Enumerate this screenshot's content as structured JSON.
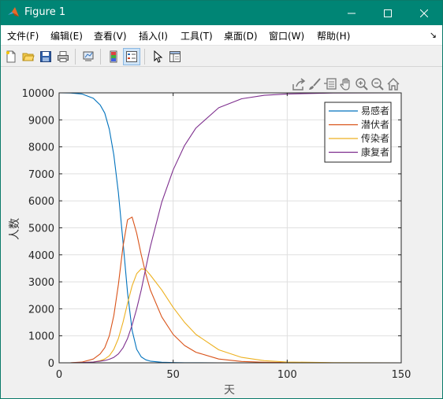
{
  "window": {
    "title": "Figure 1"
  },
  "menu": {
    "items": [
      "文件(F)",
      "编辑(E)",
      "查看(V)",
      "插入(I)",
      "工具(T)",
      "桌面(D)",
      "窗口(W)",
      "帮助(H)"
    ]
  },
  "toolbar": {
    "buttons": [
      "new-figure",
      "open-file",
      "save",
      "print",
      "link-plot",
      "insert-colorbar",
      "insert-legend",
      "edit-plot",
      "property-inspector"
    ]
  },
  "axes_toolbar": {
    "buttons": [
      "export",
      "brush",
      "data-tips",
      "pan",
      "zoom-in",
      "zoom-out",
      "restore-view"
    ]
  },
  "chart_data": {
    "type": "line",
    "title": "",
    "xlabel": "天",
    "ylabel": "人数",
    "xlim": [
      0,
      150
    ],
    "ylim": [
      0,
      10000
    ],
    "xticks": [
      0,
      50,
      100,
      150
    ],
    "yticks": [
      0,
      1000,
      2000,
      3000,
      4000,
      5000,
      6000,
      7000,
      8000,
      9000,
      10000
    ],
    "grid": true,
    "legend_position": "top-right",
    "x": [
      0,
      5,
      10,
      15,
      18,
      20,
      22,
      24,
      26,
      28,
      30,
      32,
      34,
      36,
      38,
      40,
      45,
      50,
      55,
      60,
      70,
      80,
      90,
      100,
      120,
      150
    ],
    "series": [
      {
        "name": "易感者",
        "color": "#0072BD",
        "values": [
          10000,
          9995,
          9960,
          9800,
          9550,
          9250,
          8650,
          7700,
          6300,
          4500,
          2600,
          1200,
          500,
          220,
          110,
          60,
          20,
          8,
          4,
          2,
          1,
          0,
          0,
          0,
          0,
          0
        ]
      },
      {
        "name": "潜伏者",
        "color": "#D95319",
        "values": [
          0,
          3,
          25,
          140,
          330,
          560,
          1000,
          1750,
          2900,
          4300,
          5300,
          5400,
          4800,
          4000,
          3300,
          2700,
          1700,
          1050,
          640,
          390,
          140,
          50,
          20,
          8,
          1,
          0
        ]
      },
      {
        "name": "传染者",
        "color": "#EDB120",
        "values": [
          0,
          1,
          6,
          30,
          80,
          140,
          260,
          500,
          900,
          1500,
          2200,
          2850,
          3300,
          3480,
          3450,
          3250,
          2700,
          2050,
          1500,
          1050,
          480,
          200,
          80,
          30,
          5,
          0
        ]
      },
      {
        "name": "康复者",
        "color": "#7E2F8E",
        "values": [
          0,
          1,
          10,
          30,
          60,
          85,
          130,
          200,
          330,
          550,
          900,
          1400,
          2000,
          2700,
          3500,
          4300,
          5950,
          7150,
          8050,
          8700,
          9450,
          9780,
          9910,
          9960,
          9995,
          10000
        ]
      }
    ]
  }
}
